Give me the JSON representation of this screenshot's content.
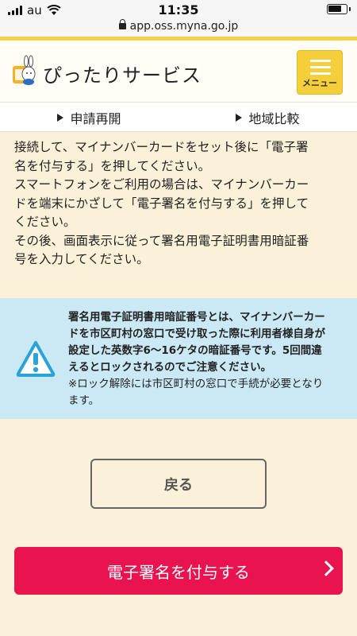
{
  "status_bar": {
    "carrier": "au",
    "time": "11:35",
    "url": "app.oss.myna.go.jp"
  },
  "header": {
    "title": "ぴったりサービス",
    "menu_label": "メニュー"
  },
  "subnav": {
    "items": [
      {
        "label": "申請再開"
      },
      {
        "label": "地域比較"
      }
    ]
  },
  "body": {
    "lines": [
      "接続して、マイナンバーカードをセット後に「電子署",
      "名を付与する」を押してください。",
      "スマートフォンをご利用の場合は、マイナンバーカー",
      "ドを端末にかざして「電子署名を付与する」を押して",
      "ください。",
      "その後、画面表示に従って署名用電子証明書用暗証番",
      "号を入力してください。"
    ]
  },
  "notice": {
    "bold_lines": [
      "署名用電子証明書用暗証番号とは、マイナンバーカー",
      "ドを市区町村の窓口で受け取った際に利用者様自身が",
      "設定した英数字6〜16ケタの暗証番号です。5回間違",
      "えるとロックされるのでご注意ください。"
    ],
    "note_lines": [
      "※ロック解除には市区町村の窓口で手続が必要となり",
      "ます。"
    ],
    "icon": "warning-icon"
  },
  "buttons": {
    "back_label": "戻る",
    "sign_label": "電子署名を付与する"
  },
  "colors": {
    "background": "#fbf1d9",
    "accent_yellow": "#f5cf3a",
    "notice_bg": "#cbe9f5",
    "primary_red": "#e8134f"
  }
}
